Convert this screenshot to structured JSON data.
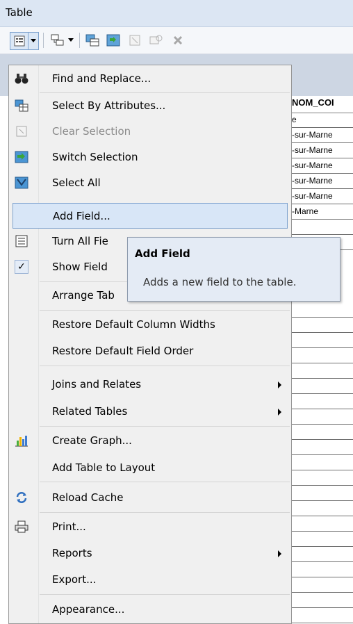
{
  "window": {
    "title": "Table"
  },
  "table": {
    "column_header": "NOM_COI",
    "rows": [
      "e",
      "-sur-Marne",
      "-sur-Marne",
      "-sur-Marne",
      "-sur-Marne",
      "-sur-Marne",
      "-Marne"
    ]
  },
  "menu": {
    "find_replace": "Find and Replace...",
    "select_by_attributes": "Select By Attributes...",
    "clear_selection": "Clear Selection",
    "switch_selection": "Switch Selection",
    "select_all": "Select All",
    "add_field": "Add Field...",
    "turn_all_fields": "Turn All Fie",
    "show_field": "Show Field",
    "arrange_tables": "Arrange Tab",
    "restore_widths": "Restore Default Column Widths",
    "restore_order": "Restore Default Field Order",
    "joins_relates": "Joins and Relates",
    "related_tables": "Related Tables",
    "create_graph": "Create Graph...",
    "add_table_layout": "Add Table to Layout",
    "reload_cache": "Reload Cache",
    "print": "Print...",
    "reports": "Reports",
    "export": "Export...",
    "appearance": "Appearance..."
  },
  "tooltip": {
    "title": "Add Field",
    "body": "Adds a new field to the table."
  },
  "colors": {
    "hover_bg": "#d8e6f7",
    "hover_border": "#7da2ce",
    "titlebar": "#dce6f3"
  }
}
